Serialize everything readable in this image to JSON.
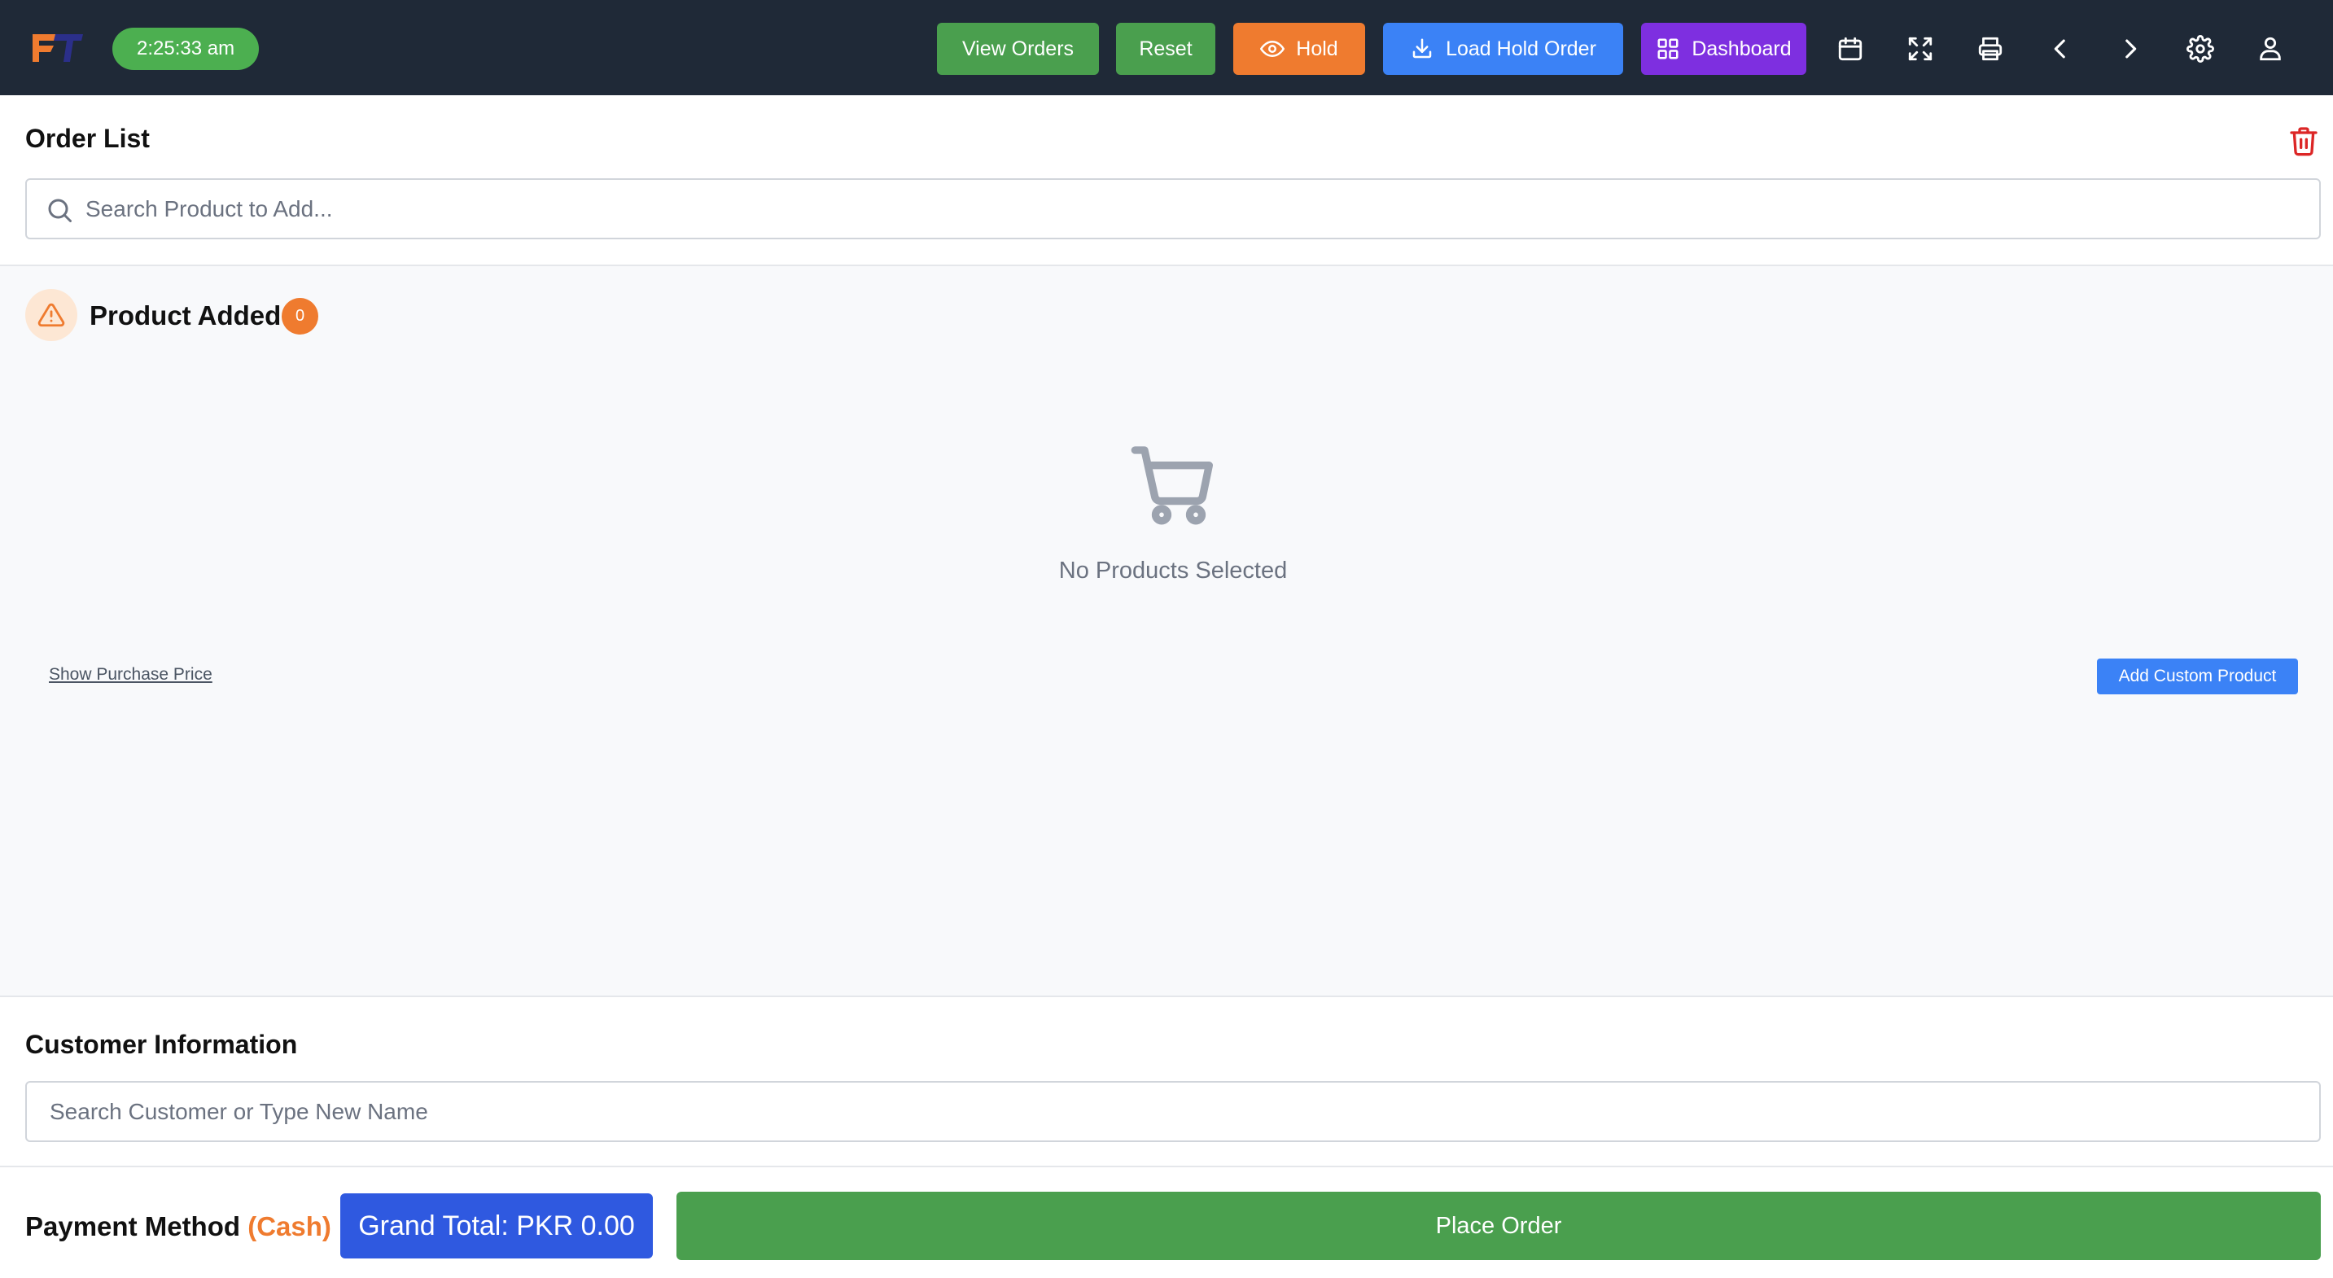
{
  "header": {
    "logo_text": "FT",
    "clock": "2:25:33 am",
    "buttons": {
      "view_orders": "View Orders",
      "reset": "Reset",
      "hold": "Hold",
      "load_hold_order": "Load Hold Order",
      "dashboard": "Dashboard"
    },
    "icons": [
      "calendar-icon",
      "fullscreen-icon",
      "printer-icon",
      "chevron-left-icon",
      "chevron-right-icon",
      "gear-icon",
      "user-icon"
    ]
  },
  "order_list": {
    "title": "Order List",
    "search_placeholder": "Search Product to Add..."
  },
  "products": {
    "title": "Product Added",
    "count": "0",
    "empty_text": "No Products Selected",
    "show_purchase_price": "Show Purchase Price",
    "add_custom_product": "Add Custom Product"
  },
  "customer": {
    "title": "Customer Information",
    "search_placeholder": "Search Customer or Type New Name"
  },
  "footer": {
    "payment_label": "Payment Method",
    "payment_method": "(Cash)",
    "grand_total": "Grand Total: PKR 0.00",
    "place_order": "Place Order"
  },
  "colors": {
    "topbar": "#1f2937",
    "green": "#4a9f4e",
    "orange": "#ef7b2f",
    "blue": "#3b82f6",
    "purple": "#7e2fe0",
    "grand_total_blue": "#2f59e0",
    "danger_red": "#dc2626"
  }
}
